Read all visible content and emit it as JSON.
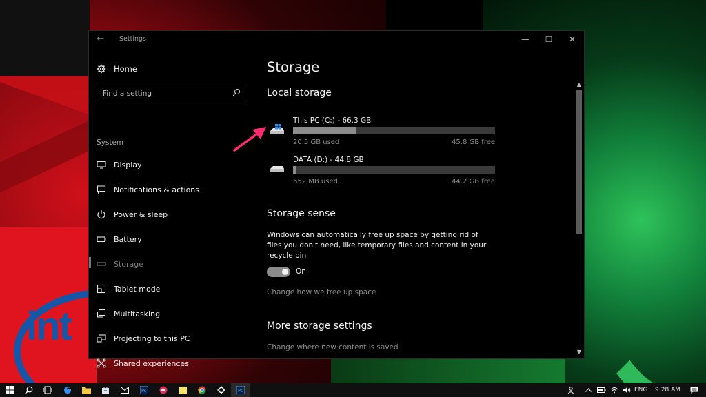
{
  "window": {
    "title": "Settings",
    "back": "←",
    "minimize": "—",
    "maximize": "☐",
    "close": "✕"
  },
  "sidebar": {
    "home_label": "Home",
    "search_placeholder": "Find a setting",
    "group_title": "System",
    "items": [
      {
        "label": "Display",
        "icon": "display-icon"
      },
      {
        "label": "Notifications & actions",
        "icon": "notifications-icon"
      },
      {
        "label": "Power & sleep",
        "icon": "power-icon"
      },
      {
        "label": "Battery",
        "icon": "battery-icon"
      },
      {
        "label": "Storage",
        "icon": "storage-icon",
        "selected": true
      },
      {
        "label": "Tablet mode",
        "icon": "tablet-mode-icon"
      },
      {
        "label": "Multitasking",
        "icon": "multitasking-icon"
      },
      {
        "label": "Projecting to this PC",
        "icon": "projecting-icon"
      },
      {
        "label": "Shared experiences",
        "icon": "shared-experiences-icon"
      }
    ]
  },
  "main": {
    "page_title": "Storage",
    "local_storage_title": "Local storage",
    "drives": [
      {
        "name": "This PC (C:) - 66.3 GB",
        "used": "20.5 GB used",
        "free": "45.8 GB free",
        "used_fraction": 0.31
      },
      {
        "name": "DATA (D:) - 44.8 GB",
        "used": "652 MB used",
        "free": "44.2 GB free",
        "used_fraction": 0.015
      }
    ],
    "storage_sense_title": "Storage sense",
    "storage_sense_desc": "Windows can automatically free up space by getting rid of files you don't need, like temporary files and content in your recycle bin",
    "toggle_state": "On",
    "change_free_up_link": "Change how we free up space",
    "more_settings_title": "More storage settings",
    "change_content_link": "Change where new content is saved"
  },
  "taskbar": {
    "apps": [
      "start-icon",
      "search-icon",
      "task-view-icon",
      "edge-icon",
      "file-explorer-icon",
      "store-icon",
      "mail-icon",
      "photoshop-icon",
      "app-icon",
      "sticky-notes-icon",
      "chrome-icon",
      "settings-icon",
      "photoshop-icon"
    ],
    "language": "ENG",
    "time": "9:28 AM"
  },
  "colors": {
    "accent": "#8c8c8c",
    "annotation": "#ff2d6f",
    "drive_icon": "#2f8ff3"
  }
}
